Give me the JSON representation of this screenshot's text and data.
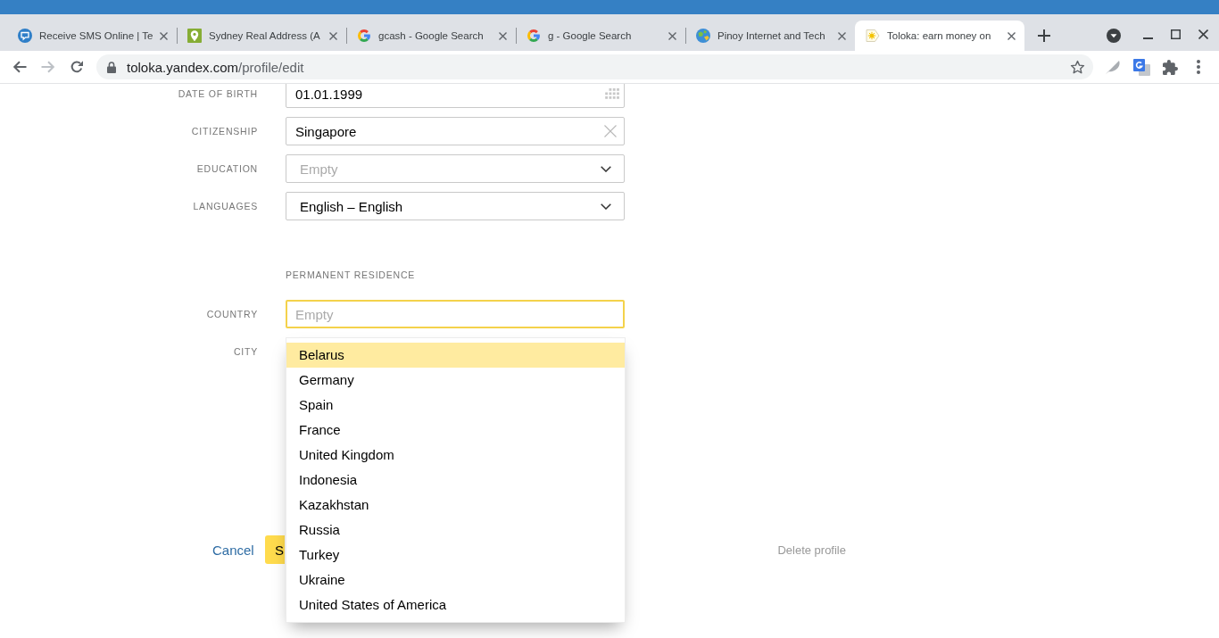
{
  "browser": {
    "tabs": [
      {
        "title": "Receive SMS Online | Te",
        "kind": "chat",
        "selected": false
      },
      {
        "title": "Sydney Real Address (A",
        "kind": "pin",
        "selected": false
      },
      {
        "title": "gcash - Google Search",
        "kind": "google",
        "selected": false
      },
      {
        "title": "g - Google Search",
        "kind": "google",
        "selected": false
      },
      {
        "title": "Pinoy Internet and Tech",
        "kind": "globe",
        "selected": false
      },
      {
        "title": "Toloka: earn money on",
        "kind": "sun",
        "selected": true
      }
    ]
  },
  "toolbar": {
    "back_disabled": false,
    "forward_disabled": true,
    "url_host": "toloka.yandex.com",
    "url_path": "/profile/edit"
  },
  "profile_form": {
    "fields": [
      {
        "label": "DATE OF BIRTH",
        "kind": "date",
        "value": "01.01.1999"
      },
      {
        "label": "CITIZENSHIP",
        "kind": "clearable",
        "value": "Singapore"
      },
      {
        "label": "EDUCATION",
        "kind": "select",
        "placeholder": "Empty"
      },
      {
        "label": "LANGUAGES",
        "kind": "select",
        "value": "English – English"
      }
    ],
    "section_title": "PERMANENT RESIDENCE",
    "residence_fields": [
      {
        "label": "COUNTRY",
        "kind": "text",
        "placeholder": "Empty",
        "focused": true
      },
      {
        "label": "CITY"
      }
    ]
  },
  "country_dropdown": {
    "options": [
      {
        "label": "Belarus",
        "selected": true
      },
      {
        "label": "Germany",
        "selected": false
      },
      {
        "label": "Spain",
        "selected": false
      },
      {
        "label": "France",
        "selected": false
      },
      {
        "label": "United Kingdom",
        "selected": false
      },
      {
        "label": "Indonesia",
        "selected": false
      },
      {
        "label": "Kazakhstan",
        "selected": false
      },
      {
        "label": "Russia",
        "selected": false
      },
      {
        "label": "Turkey",
        "selected": false
      },
      {
        "label": "Ukraine",
        "selected": false
      },
      {
        "label": "United States of America",
        "selected": false
      }
    ]
  },
  "actions": {
    "cancel": "Cancel",
    "save": "S",
    "delete": "Delete profile"
  }
}
